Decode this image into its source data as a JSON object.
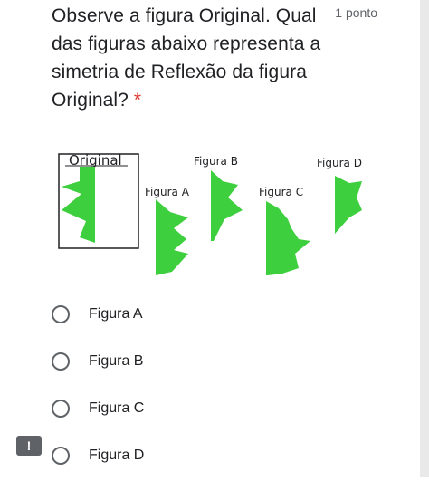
{
  "question": {
    "title": "Observe a figura Original. Qual das figuras abaixo representa a simetria de Reflexão da figura Original?",
    "required_mark": "*",
    "points": "1 ponto"
  },
  "figures": {
    "original_label": "Original",
    "a_label": "Figura A",
    "b_label": "Figura B",
    "c_label": "Figura C",
    "d_label": "Figura D",
    "shape_color": "#3ecf3e"
  },
  "options": [
    {
      "label": "Figura A"
    },
    {
      "label": "Figura B"
    },
    {
      "label": "Figura C"
    },
    {
      "label": "Figura D"
    }
  ],
  "report_button": {
    "label": "!"
  }
}
